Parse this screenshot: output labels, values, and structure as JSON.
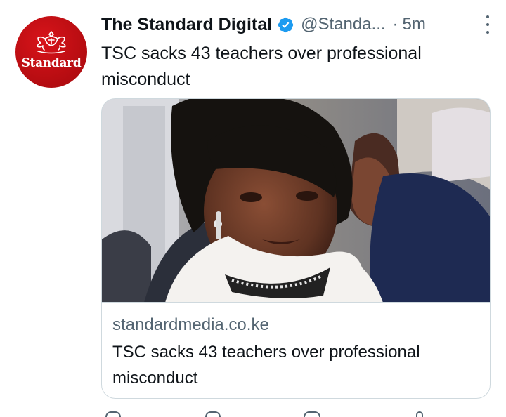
{
  "tweet": {
    "display_name": "The Standard Digital",
    "handle": "@Standa...",
    "separator": "·",
    "time": "5m",
    "text": "TSC sacks 43 teachers over professional misconduct",
    "verified": true
  },
  "avatar": {
    "wordmark": "Standard",
    "background_color": "#c3101a"
  },
  "card": {
    "domain": "standardmedia.co.ke",
    "title": "TSC sacks 43 teachers over professional misconduct"
  },
  "icons": {
    "verified": "verified-badge-icon",
    "more": "more-options-icon",
    "reply": "reply-icon",
    "retweet": "retweet-icon",
    "like": "like-icon",
    "share": "share-icon"
  },
  "colors": {
    "text": "#0f1419",
    "secondary": "#536471",
    "verified": "#1d9bf0",
    "border": "#cfd9de"
  }
}
